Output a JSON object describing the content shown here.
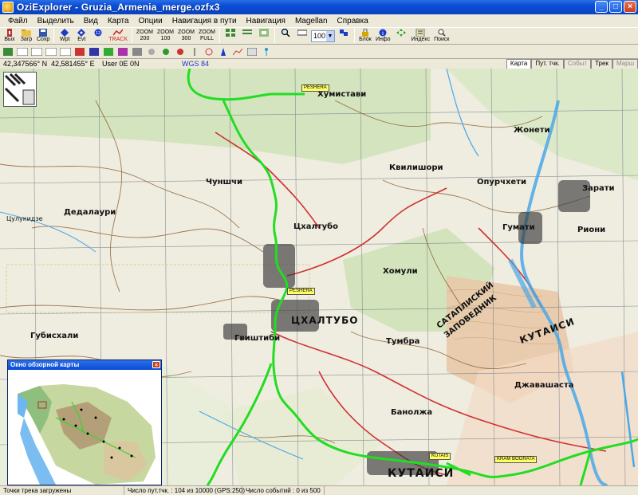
{
  "window": {
    "title": "OziExplorer - Gruzia_Armenia_merge.ozfx3",
    "minimize": "_",
    "maximize": "□",
    "close": "×"
  },
  "menu": [
    "Файл",
    "Выделить",
    "Вид",
    "Карта",
    "Опции",
    "Навигация в пути",
    "Навигация",
    "Magellan",
    "Справка"
  ],
  "toolbar": {
    "exit": "Вых",
    "load": "Загр",
    "save": "Сохр",
    "wpt": "Wpt",
    "evt": "Evt",
    "track": "TRACK",
    "scale_100": "100",
    "scale_200": "200",
    "zoom_label": "ZOOM",
    "zoom_300": "300",
    "full": "FULL",
    "zoom_value": "100",
    "block": "Блок",
    "info": "Инфо",
    "index": "Индекс",
    "search": "Поиск"
  },
  "coords": {
    "lat": "42,347566° N",
    "lon": "42,581455° E",
    "user": "User  0E   0N",
    "datum": "WGS 84"
  },
  "tabs": [
    "Карта",
    "Пут. тчк.",
    "Событ",
    "Трек",
    "Марш"
  ],
  "map_labels": {
    "khumistavi": "Хумистави",
    "zhoneti": "Жонети",
    "kvilishori": "Квилишори",
    "opurchkheti": "Опурчхети",
    "zarati": "Зарати",
    "chunshi": "Чуншчи",
    "tskaltubo_upper": "Цхалтубо",
    "gumati": "Гумати",
    "rioni": "Риони",
    "dedalauri": "Дедалаури",
    "khomuli": "Хомули",
    "tskaltubo_big": "ЦХАЛТУБО",
    "satap_1": "САТАПЛИСКИЙ",
    "satap_2": "ЗАПОВЕДНИК",
    "kutaisi_side": "КУТАИСИ",
    "gvishtibi": "Гвиштиби",
    "tumbra": "Тумбра",
    "gubiskali": "Губисхали",
    "banodzha": "Банолжа",
    "kutaisi_main": "КУТАИСИ",
    "dzhashastavi": "Джавашаста",
    "tsulukidze": "Цулукидзе"
  },
  "waypoints": {
    "wp1": "PESHERA",
    "wp2": "PESHERA",
    "wp3": "KUTAIS",
    "wp4": "KRAM BOGRATA"
  },
  "overview": {
    "title": "Окно обзорной карты",
    "close": "×"
  },
  "status": {
    "track": "Точки трека загружены",
    "wpts": "Число пут.тчк. : 104 из 10000  (GPS:250)",
    "events": "Число событий : 0 из 500"
  },
  "colors": {
    "track": "#22dd22",
    "river": "#4aa8e8",
    "road": "#d03030",
    "forest": "#cfe3b8"
  }
}
